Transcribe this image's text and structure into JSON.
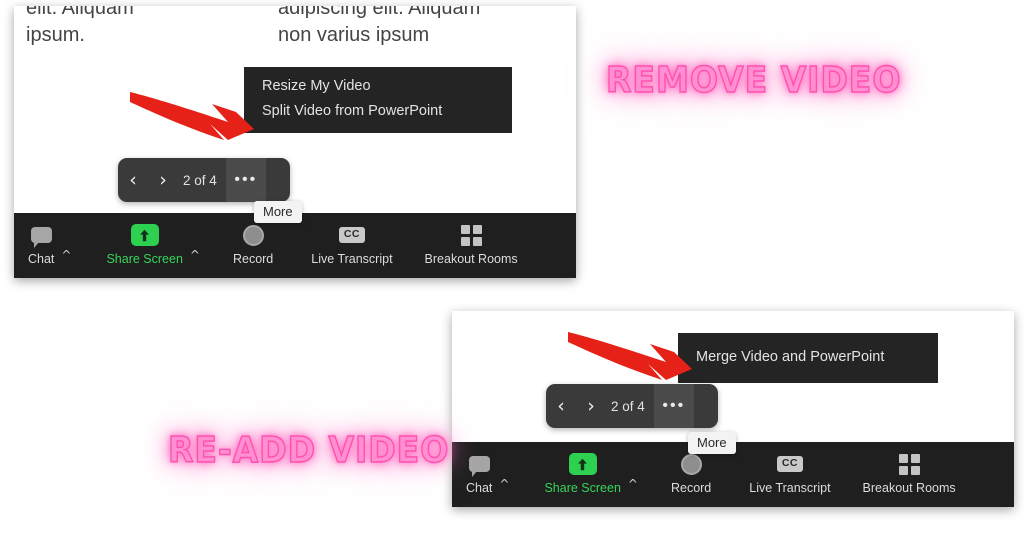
{
  "page": {
    "background": "#ffffff",
    "accent_green": "#2ed14f",
    "neon_pink": "#ff8fd0",
    "arrow_red": "#e62117",
    "dark_menu": "#242424",
    "toolbar_bg": "#1f1f1f"
  },
  "captions": {
    "remove": "REMOVE VIDEO",
    "readd": "RE-ADD VIDEO"
  },
  "top_panel": {
    "slide": {
      "left_column": "elit. Aliquam\nipsum.",
      "left_line1": "elit. Aliquam",
      "left_line2": "ipsum.",
      "right_line1": "adipiscing elit. Aliquam",
      "right_line2": "non varius ipsum"
    },
    "context_menu": {
      "items": [
        {
          "label": "Resize My Video"
        },
        {
          "label": "Split Video from PowerPoint"
        }
      ]
    },
    "nav_pill": {
      "prev_icon": "chevron-left-icon",
      "next_icon": "chevron-right-icon",
      "prev": "‹",
      "next": "›",
      "counter": "2 of 4",
      "more": "•••"
    },
    "tooltip": "More",
    "toolbar": {
      "items": [
        {
          "label": "Chat",
          "icon": "chat-bubble-icon",
          "caret": "^",
          "green": false
        },
        {
          "label": "Share Screen",
          "icon": "share-screen-up-arrow-icon",
          "caret": "^",
          "green": true
        },
        {
          "label": "Record",
          "icon": "record-circle-icon",
          "caret": "",
          "green": false
        },
        {
          "label": "Live Transcript",
          "icon": "closed-caption-icon",
          "icon_text": "CC",
          "caret": "",
          "green": false
        },
        {
          "label": "Breakout Rooms",
          "icon": "grid-four-squares-icon",
          "caret": "",
          "green": false
        }
      ]
    }
  },
  "bottom_panel": {
    "context_menu": {
      "items": [
        {
          "label": "Merge Video and PowerPoint"
        }
      ]
    },
    "nav_pill": {
      "prev": "‹",
      "next": "›",
      "counter": "2 of 4",
      "more": "•••"
    },
    "tooltip": "More",
    "toolbar": {
      "items": [
        {
          "label": "Chat",
          "icon": "chat-bubble-icon",
          "caret": "^",
          "green": false
        },
        {
          "label": "Share Screen",
          "icon": "share-screen-up-arrow-icon",
          "caret": "^",
          "green": true
        },
        {
          "label": "Record",
          "icon": "record-circle-icon",
          "caret": "",
          "green": false
        },
        {
          "label": "Live Transcript",
          "icon": "closed-caption-icon",
          "icon_text": "CC",
          "caret": "",
          "green": false
        },
        {
          "label": "Breakout Rooms",
          "icon": "grid-four-squares-icon",
          "caret": "",
          "green": false
        }
      ]
    }
  }
}
